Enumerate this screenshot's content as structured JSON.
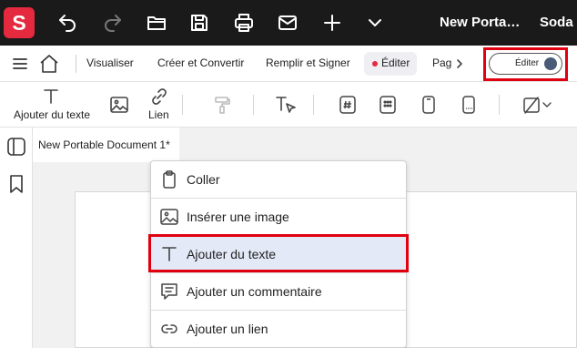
{
  "app": {
    "logo_letter": "S",
    "title": "New Porta…",
    "title_suffix": "Soda P"
  },
  "titlebar_icons": [
    "undo-icon",
    "redo-icon",
    "open-folder-icon",
    "save-icon",
    "print-icon",
    "mail-icon",
    "plus-icon",
    "chevron-down-icon"
  ],
  "menu": {
    "items": [
      {
        "label": "Visualiser"
      },
      {
        "label": "Créer et Convertir"
      },
      {
        "label": "Remplir et Signer"
      },
      {
        "label": "Éditer",
        "active": true
      },
      {
        "label": "Pag"
      }
    ],
    "toggle_label": "Éditer"
  },
  "toolbar": {
    "add_text_label": "Ajouter du texte",
    "link_label": "Lien"
  },
  "document": {
    "tab_title": "New Portable Document 1*"
  },
  "context_menu": {
    "items": [
      {
        "label": "Coller",
        "icon": "clipboard-icon"
      },
      {
        "label": "Insérer une image",
        "icon": "image-icon"
      },
      {
        "label": "Ajouter du texte",
        "icon": "text-icon",
        "highlighted": true
      },
      {
        "label": "Ajouter un commentaire",
        "icon": "comment-icon"
      },
      {
        "label": "Ajouter un lien",
        "icon": "link-icon"
      }
    ]
  },
  "colors": {
    "brand": "#e5293e",
    "titlebar_bg": "#1a1a1a",
    "highlight_bg": "#e3e9f7",
    "annotation_red": "#e00010"
  }
}
